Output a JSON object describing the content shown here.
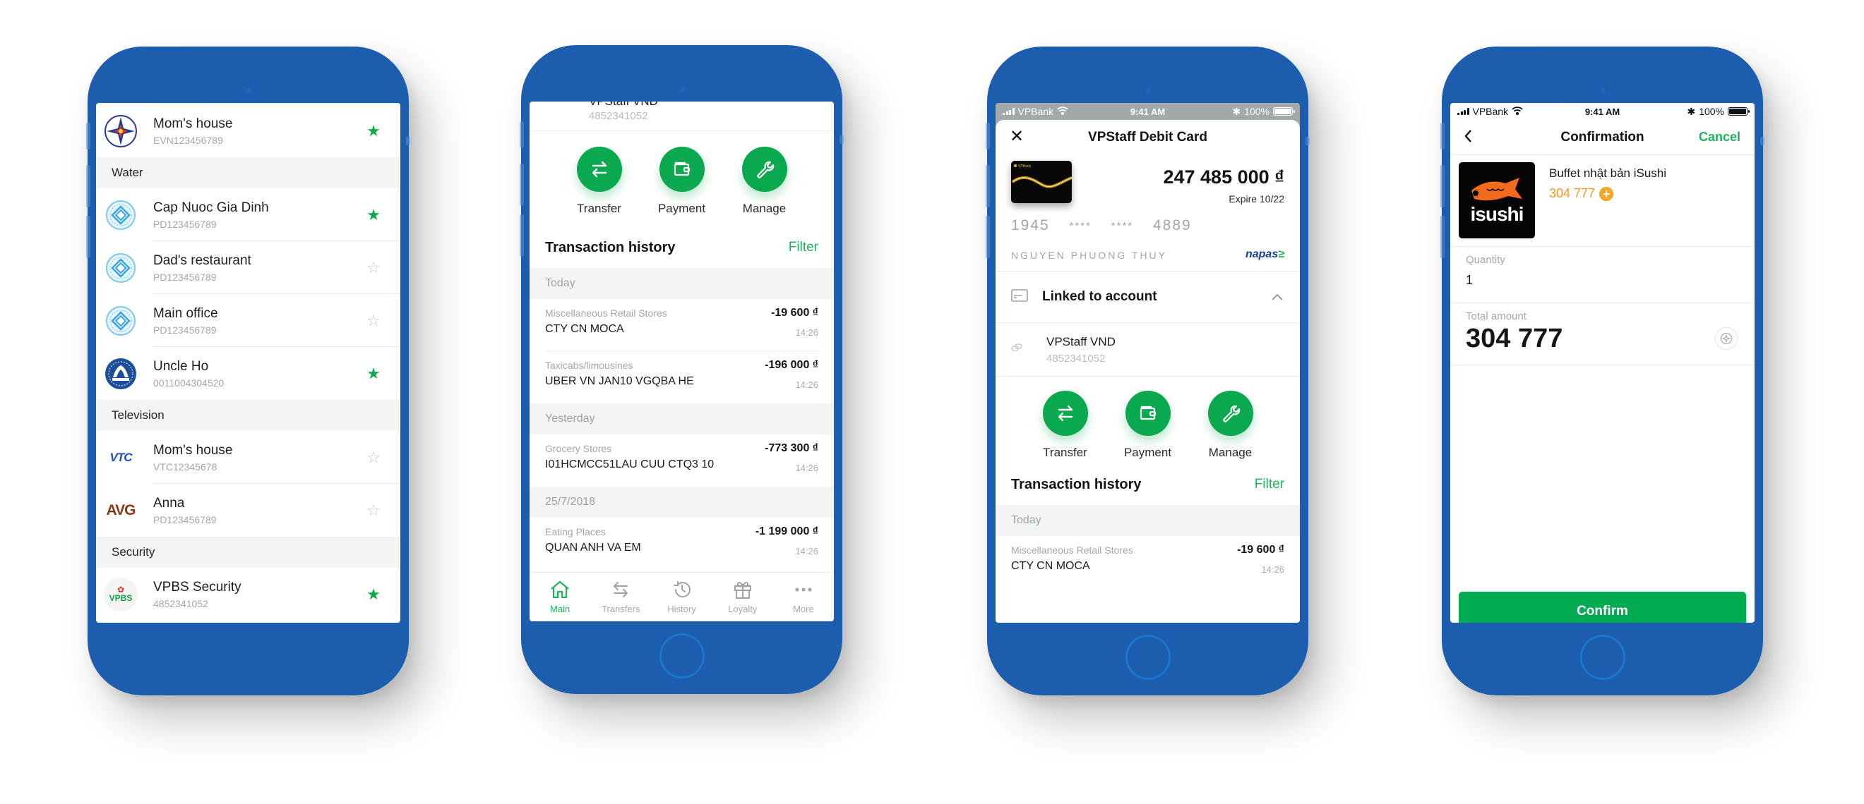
{
  "phone1": {
    "top_item": {
      "name": "Mom's house",
      "code": "EVN123456789",
      "favorite": true,
      "logo": "evn-logo"
    },
    "sections": [
      {
        "title": "Water",
        "items": [
          {
            "name": "Cap Nuoc Gia Dinh",
            "code": "PD123456789",
            "favorite": true,
            "logo": "gia-dinh-water-logo"
          },
          {
            "name": "Dad's restaurant",
            "code": "PD123456789",
            "favorite": false,
            "logo": "gia-dinh-water-logo"
          },
          {
            "name": "Main office",
            "code": "PD123456789",
            "favorite": false,
            "logo": "gia-dinh-water-logo"
          },
          {
            "name": "Uncle Ho",
            "code": "0011004304520",
            "favorite": true,
            "logo": "sawaco-logo"
          }
        ]
      },
      {
        "title": "Television",
        "items": [
          {
            "name": "Mom's house",
            "code": "VTC12345678",
            "favorite": false,
            "logo": "vtc-logo"
          },
          {
            "name": "Anna",
            "code": "PD123456789",
            "favorite": false,
            "logo": "avg-logo"
          }
        ]
      },
      {
        "title": "Security",
        "items": [
          {
            "name": "VPBS Security",
            "code": "4852341052",
            "favorite": true,
            "logo": "vpbs-logo"
          }
        ]
      }
    ],
    "logo_text": {
      "vtc": "VTC",
      "avg": "AVG",
      "vpbs": "VPBS"
    }
  },
  "phone2": {
    "account": {
      "name": "VPStaff VND",
      "number": "4852341052"
    },
    "actions": [
      {
        "label": "Transfer",
        "icon": "transfer-icon"
      },
      {
        "label": "Payment",
        "icon": "wallet-icon"
      },
      {
        "label": "Manage",
        "icon": "wrench-icon"
      }
    ],
    "history_title": "Transaction history",
    "filter_label": "Filter",
    "groups": [
      {
        "label": "Today",
        "transactions": [
          {
            "category": "Miscellaneous Retail Stores",
            "merchant": "CTY CN MOCA",
            "amount": "-19 600 ₫",
            "time": "14:26"
          },
          {
            "category": "Taxicabs/limousines",
            "merchant": "UBER VN JAN10 VGQBA HE",
            "amount": "-196 000 ₫",
            "time": "14:26"
          }
        ]
      },
      {
        "label": "Yesterday",
        "transactions": [
          {
            "category": "Grocery Stores",
            "merchant": "I01HCMCC51LAU CUU CTQ3 10",
            "amount": "-773 300 ₫",
            "time": "14:26"
          }
        ]
      },
      {
        "label": "25/7/2018",
        "transactions": [
          {
            "category": "Eating Places",
            "merchant": "QUAN ANH VA EM",
            "amount": "-1 199 000 ₫",
            "time": "14:26"
          }
        ]
      }
    ],
    "tabs": [
      {
        "label": "Main",
        "icon": "home-icon",
        "active": true
      },
      {
        "label": "Transfers",
        "icon": "transfers-icon",
        "active": false
      },
      {
        "label": "History",
        "icon": "history-icon",
        "active": false
      },
      {
        "label": "Loyalty",
        "icon": "gift-icon",
        "active": false
      },
      {
        "label": "More",
        "icon": "more-icon",
        "active": false
      }
    ]
  },
  "status_bar": {
    "carrier": "VPBank",
    "time": "9:41 AM",
    "battery": "100%"
  },
  "phone3": {
    "title": "VPStaff Debit Card",
    "card_brand": "VPBank",
    "balance": "247 485 000 ₫",
    "expire": "Expire 10/22",
    "pan": [
      "1945",
      "****",
      "****",
      "4889"
    ],
    "holder": "NGUYEN PHUONG THUY",
    "network": "napas",
    "linked_title": "Linked to account",
    "linked_account": {
      "name": "VPStaff VND",
      "number": "4852341052"
    },
    "actions": [
      {
        "label": "Transfer"
      },
      {
        "label": "Payment"
      },
      {
        "label": "Manage"
      }
    ],
    "history_title": "Transaction history",
    "filter_label": "Filter",
    "group_label": "Today",
    "transaction": {
      "category": "Miscellaneous Retail Stores",
      "merchant": "CTY CN MOCA",
      "amount": "-19 600 ₫",
      "time": "14:26"
    }
  },
  "phone4": {
    "title": "Confirmation",
    "cancel_label": "Cancel",
    "product": {
      "name": "Buffet nhật bản iSushi",
      "price": "304 777",
      "logo_text": "isushi"
    },
    "quantity_label": "Quantity",
    "quantity_value": "1",
    "total_label": "Total amount",
    "total_value": "304 777",
    "confirm_label": "Confirm"
  },
  "colors": {
    "frame": "#1c5dad",
    "accent": "#0aa84f",
    "points": "#f59a1c"
  }
}
